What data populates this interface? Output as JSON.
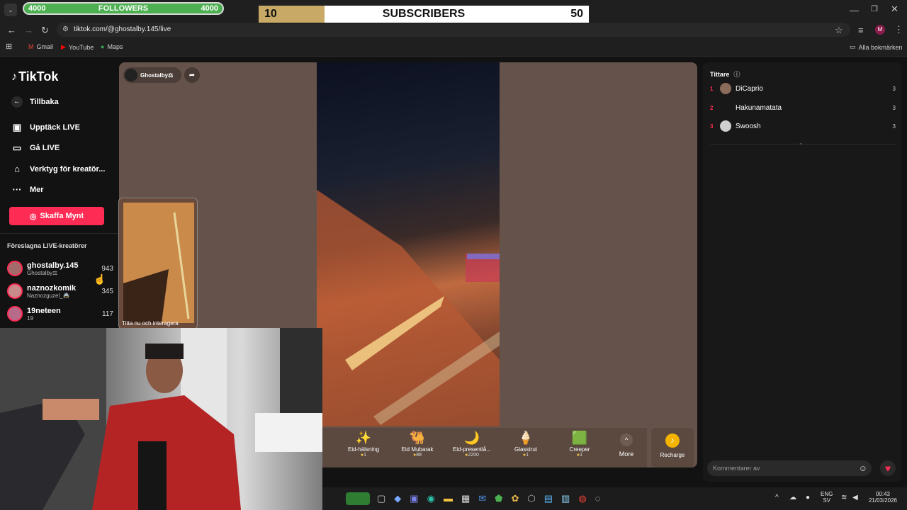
{
  "overlay": {
    "followers": {
      "left": "4000",
      "label": "FOLLOWERS",
      "right": "4000"
    },
    "subscribers": {
      "current": "10",
      "label": "SUBSCRIBERS",
      "goal": "50",
      "progress": 0.2
    }
  },
  "browser": {
    "url": "tiktok.com/@ghostalby.145/live",
    "bookmarks": [
      "Gmail",
      "YouTube",
      "Maps"
    ],
    "all_bookmarks": "Alla bokmärken",
    "profile_initial": "M"
  },
  "sidebar": {
    "logo": "TikTok",
    "back": "Tillbaka",
    "nav": [
      "Upptäck LIVE",
      "Gå LIVE",
      "Verktyg för kreatör...",
      "Mer"
    ],
    "cta": "Skaffa Mynt",
    "section_title": "Föreslagna LIVE-kreatörer",
    "creators": [
      {
        "name": "ghostalby.145",
        "sub": "Ghostalby⚖",
        "count": "943"
      },
      {
        "name": "naznozkomik",
        "sub": "Naznozguzel_🚔",
        "count": "345"
      },
      {
        "name": "19neteen",
        "sub": "19",
        "count": "117"
      }
    ]
  },
  "live": {
    "host": "Ghostalby⚖",
    "mini_label": "Titta nu och interagera"
  },
  "gifts": [
    {
      "name": "Eid-hälsning",
      "price": "1",
      "icon": "✨"
    },
    {
      "name": "Eid Mubarak",
      "price": "88",
      "icon": "🐫"
    },
    {
      "name": "Eid-presentlå...",
      "price": "2200",
      "icon": "🌙"
    },
    {
      "name": "Glasstrut",
      "price": "1",
      "icon": "🍦"
    },
    {
      "name": "Creeper",
      "price": "1",
      "icon": "🟩"
    }
  ],
  "gift_more": "More",
  "recharge": "Recharge",
  "viewers": {
    "title": "Tittare",
    "list": [
      {
        "rank": "1",
        "name": "DiCaprio",
        "count": "3"
      },
      {
        "rank": "2",
        "name": "Hakunamatata",
        "count": "3"
      },
      {
        "rank": "3",
        "name": "Swoosh",
        "count": "3"
      }
    ],
    "comment_placeholder": "Kommentarer av"
  },
  "taskbar": {
    "lang": "ENG",
    "lang_sub": "SV",
    "time": "00:43",
    "date": "21/03/2026"
  }
}
